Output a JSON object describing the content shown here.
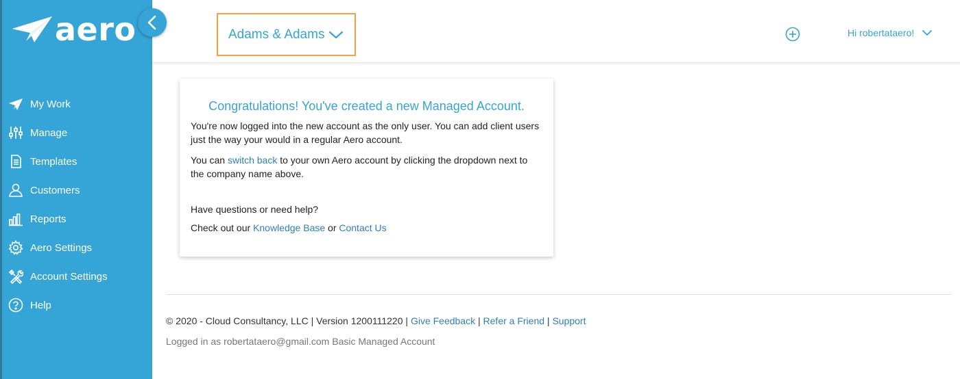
{
  "brand": {
    "logo_text": "aero",
    "color": "#35a4d6"
  },
  "sidebar": {
    "items": [
      {
        "label": "My Work",
        "icon": "paper-plane-icon"
      },
      {
        "label": "Manage",
        "icon": "sliders-icon"
      },
      {
        "label": "Templates",
        "icon": "document-icon"
      },
      {
        "label": "Customers",
        "icon": "user-icon"
      },
      {
        "label": "Reports",
        "icon": "bar-chart-icon"
      },
      {
        "label": "Aero Settings",
        "icon": "gear-icon"
      },
      {
        "label": "Account Settings",
        "icon": "tools-icon"
      },
      {
        "label": "Help",
        "icon": "help-icon"
      }
    ]
  },
  "header": {
    "company_name": "Adams & Adams",
    "user_greeting": "Hi robertataero!",
    "highlight_color": "#f5a03a"
  },
  "card": {
    "title": "Congratulations! You've created a new Managed Account.",
    "paragraph1": "You're now logged into the new account as the only user. You can add client users just the way your would in a regular Aero account.",
    "paragraph2_prefix": "You can ",
    "paragraph2_link": "switch back",
    "paragraph2_suffix": " to your own Aero account by clicking the dropdown next to the company name above.",
    "help_question": "Have questions or need help?",
    "help_prefix": "Check out our ",
    "knowledge_base_link": "Knowledge Base",
    "help_or": " or ",
    "contact_link": "Contact Us"
  },
  "footer": {
    "copyright": "© 2020 - Cloud Consultancy, LLC | Version 1200111220 | ",
    "give_feedback": "Give Feedback",
    "sep1": " | ",
    "refer_friend": "Refer a Friend",
    "sep2": " | ",
    "support": "Support",
    "logged_in": "Logged in as robertataero@gmail.com Basic Managed Account"
  }
}
